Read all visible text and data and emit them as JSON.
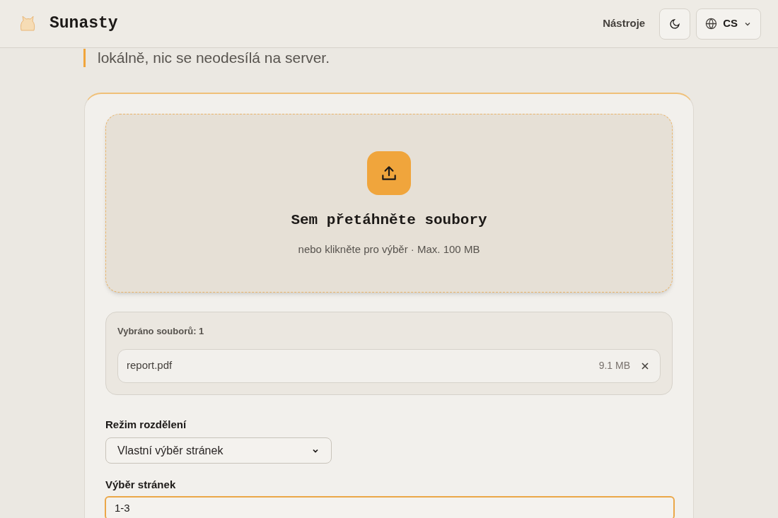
{
  "header": {
    "brand": "Sunasty",
    "nav_link": "Nástroje",
    "language": "CS"
  },
  "intro": "lokálně, nic se neodesílá na server.",
  "dropzone": {
    "title": "Sem přetáhněte soubory",
    "hint": "nebo klikněte pro výběr · Max. 100 MB"
  },
  "files": {
    "heading": "Vybráno souborů: 1",
    "items": [
      {
        "name": "report.pdf",
        "size": "9.1 MB"
      }
    ]
  },
  "split_mode": {
    "label": "Režim rozdělení",
    "value": "Vlastní výběr stránek"
  },
  "page_selection": {
    "label": "Výběr stránek",
    "value": "1-3",
    "focused": true
  }
}
